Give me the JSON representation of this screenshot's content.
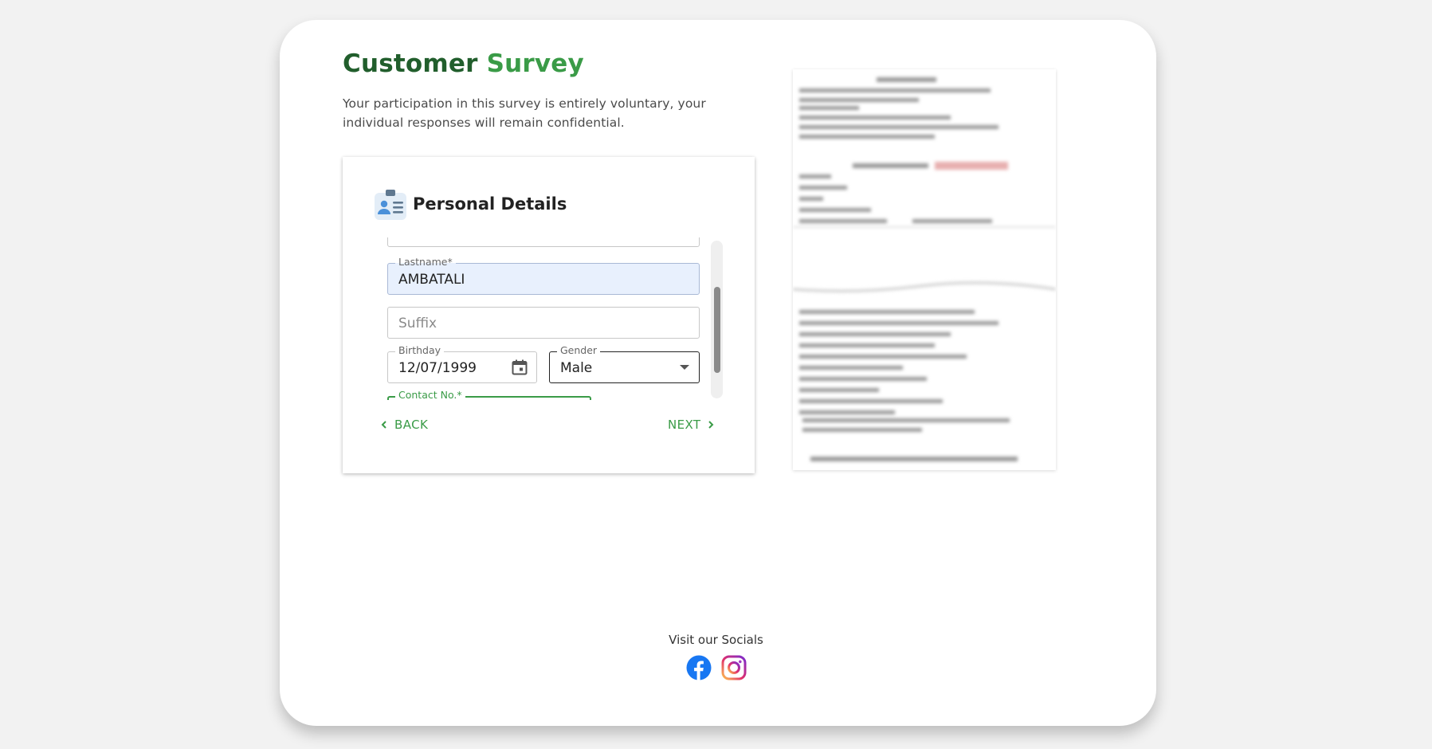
{
  "title": {
    "part1": "Customer",
    "part2": "Survey"
  },
  "intro": "Your participation in this survey is entirely voluntary, your individual responses will remain confidential.",
  "section": {
    "title": "Personal Details",
    "icon": "contact-card-icon"
  },
  "fields": {
    "lastname": {
      "label": "Lastname*",
      "value": "AMBATALI"
    },
    "suffix": {
      "placeholder": "Suffix"
    },
    "birthday": {
      "label": "Birthday",
      "value": "12/07/1999"
    },
    "gender": {
      "label": "Gender",
      "value": "Male"
    },
    "contact": {
      "label": "Contact No.*"
    }
  },
  "nav": {
    "back": "BACK",
    "next": "NEXT"
  },
  "socials": {
    "label": "Visit our Socials",
    "items": [
      "facebook-icon",
      "instagram-icon"
    ]
  },
  "colors": {
    "brand_dark": "#215e2c",
    "brand": "#3a9b47",
    "autofill_bg": "#e8f0fd"
  }
}
